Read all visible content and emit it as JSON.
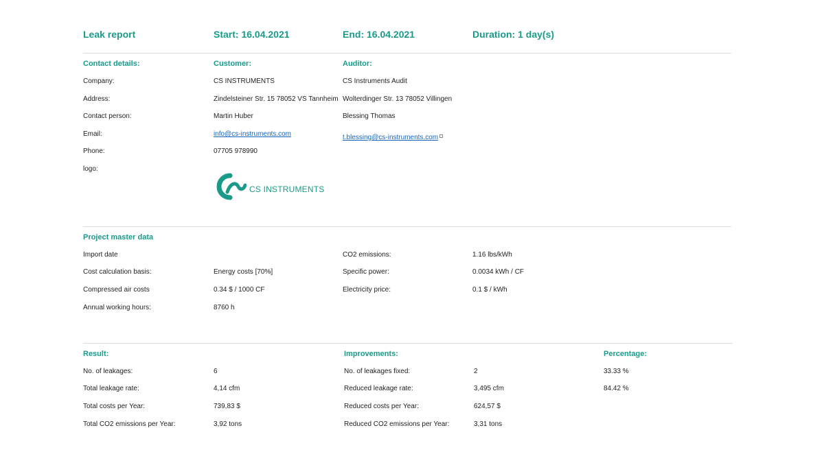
{
  "header": {
    "title": "Leak report",
    "start": "Start: 16.04.2021",
    "end": "End: 16.04.2021",
    "duration": "Duration: 1 day(s)"
  },
  "contact": {
    "heading": "Contact details:",
    "customer_heading": "Customer:",
    "auditor_heading": "Auditor:",
    "rows": [
      {
        "label": "Company:",
        "customer": "CS INSTRUMENTS",
        "auditor": "CS Instruments Audit"
      },
      {
        "label": "Address:",
        "customer": "Zindelsteiner Str. 15 78052 VS Tannheim",
        "auditor": "Wolterdinger Str. 13 78052 Villingen"
      },
      {
        "label": "Contact person:",
        "customer": "Martin Huber",
        "auditor": "Blessing Thomas"
      },
      {
        "label": "Email:",
        "customer": "info@cs-instruments.com",
        "auditor": "t.blessing@cs-instruments.com"
      },
      {
        "label": "Phone:",
        "customer": "07705 978990",
        "auditor": ""
      },
      {
        "label": "logo:",
        "customer": "",
        "auditor": ""
      }
    ],
    "logo_text": "CS INSTRUMENTS",
    "logo_color": "#199a8a"
  },
  "project": {
    "heading": "Project master data",
    "left": [
      {
        "label": "Import date",
        "value": ""
      },
      {
        "label": "Cost calculation basis:",
        "value": "Energy costs [70%]"
      },
      {
        "label": "Compressed air costs",
        "value": "0.34 $ / 1000 CF"
      },
      {
        "label": "Annual working hours:",
        "value": "8760 h"
      }
    ],
    "right": [
      {
        "label": "CO2 emissions:",
        "value": "1.16 lbs/kWh"
      },
      {
        "label": "Specific power:",
        "value": "0.0034 kWh / CF"
      },
      {
        "label": "Electricity price:",
        "value": "0.1 $ / kWh"
      }
    ]
  },
  "result": {
    "heading": "Result:",
    "improvements_heading": "Improvements:",
    "percentage_heading": "Percentage:",
    "rows": [
      {
        "label": "No. of leakages:",
        "value": "6",
        "imp_label": "No. of leakages fixed:",
        "imp_value": "2",
        "pct": "33.33 %"
      },
      {
        "label": "Total leakage rate:",
        "value": "4,14 cfm",
        "imp_label": "Reduced leakage rate:",
        "imp_value": "3,495 cfm",
        "pct": "84.42 %"
      },
      {
        "label": "Total costs per Year:",
        "value": "739,83 $",
        "imp_label": "Reduced costs per Year:",
        "imp_value": "624,57 $",
        "pct": ""
      },
      {
        "label": "Total CO2 emissions per Year:",
        "value": "3,92 tons",
        "imp_label": "Reduced CO2 emissions per Year:",
        "imp_value": "3,31 tons",
        "pct": ""
      }
    ]
  },
  "colors": {
    "accent": "#199a8a",
    "link": "#1565c0",
    "rule": "#dcdcdc"
  }
}
